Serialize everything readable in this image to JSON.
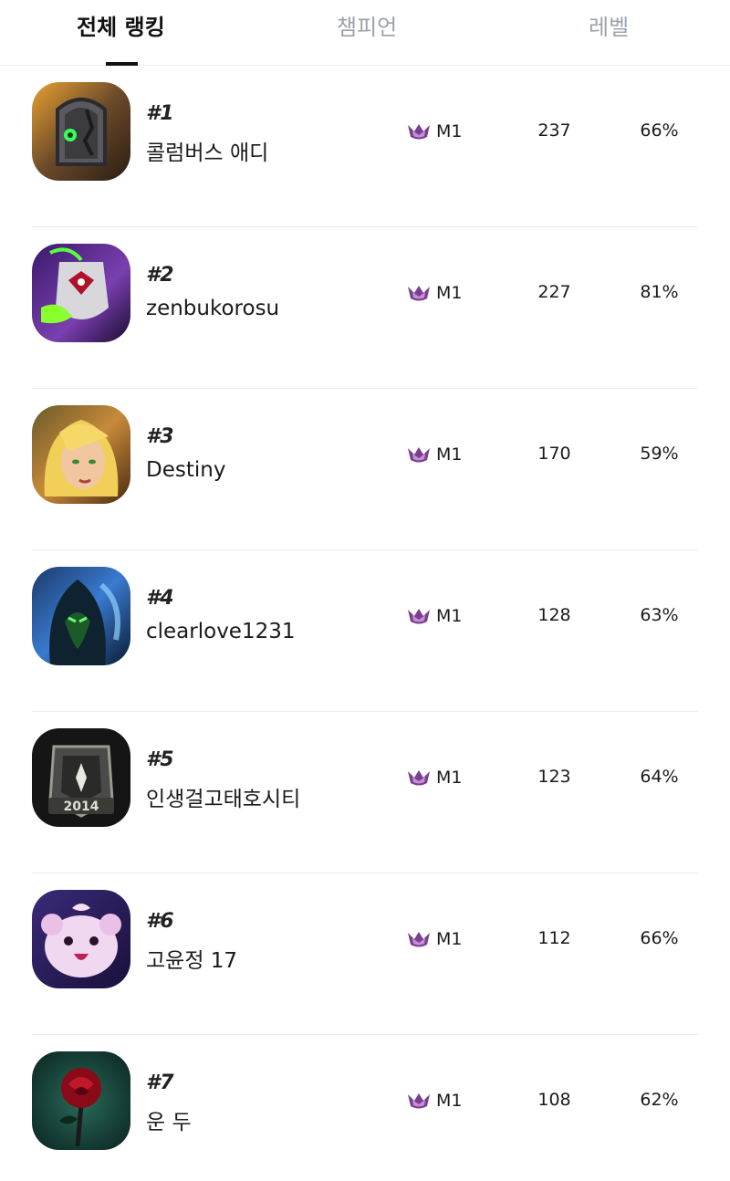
{
  "tabs": [
    {
      "label": "전체 랭킹",
      "active": true
    },
    {
      "label": "챔피언",
      "active": false
    },
    {
      "label": "레벨",
      "active": false
    }
  ],
  "colors": {
    "tier_icon": "#7b3f8f",
    "active_tab": "#111111",
    "inactive_tab": "#9aa3ad"
  },
  "players": [
    {
      "rank": "#1",
      "name": "콜럼버스 애디",
      "tier": "M1",
      "games": "237",
      "winrate": "66%",
      "avatar": "tombstone-portrait-icon"
    },
    {
      "rank": "#2",
      "name": "zenbukorosu",
      "tier": "M1",
      "games": "227",
      "winrate": "81%",
      "avatar": "creature-portrait-icon"
    },
    {
      "rank": "#3",
      "name": "Destiny",
      "tier": "M1",
      "games": "170",
      "winrate": "59%",
      "avatar": "blonde-champion-portrait-icon"
    },
    {
      "rank": "#4",
      "name": "clearlove1231",
      "tier": "M1",
      "games": "128",
      "winrate": "63%",
      "avatar": "hooded-champion-portrait-icon"
    },
    {
      "rank": "#5",
      "name": "인생걸고태호시티",
      "tier": "M1",
      "games": "123",
      "winrate": "64%",
      "avatar": "2014-badge-portrait-icon"
    },
    {
      "rank": "#6",
      "name": "고윤정 17",
      "tier": "M1",
      "games": "112",
      "winrate": "66%",
      "avatar": "poro-portrait-icon"
    },
    {
      "rank": "#7",
      "name": "운 두",
      "tier": "M1",
      "games": "108",
      "winrate": "62%",
      "avatar": "rose-portrait-icon"
    }
  ]
}
